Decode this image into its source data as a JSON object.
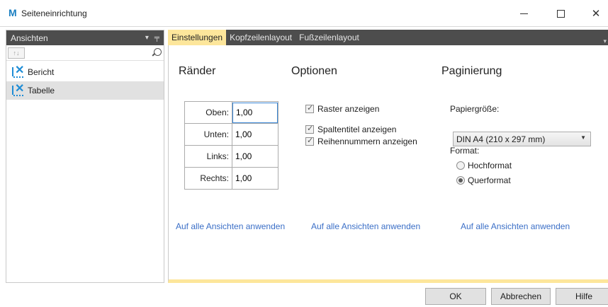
{
  "window": {
    "logo": "M",
    "title": "Seiteneinrichtung"
  },
  "left_panel": {
    "title": "Ansichten",
    "search_placeholder": "",
    "items": [
      {
        "label": "Bericht",
        "selected": false
      },
      {
        "label": "Tabelle",
        "selected": true
      }
    ]
  },
  "tabs": [
    "Einstellungen",
    "Kopfzeilenlayout",
    "Fußzeilenlayout"
  ],
  "active_tab": "Einstellungen",
  "margins": {
    "title": "Ränder",
    "rows": [
      {
        "label": "Oben:",
        "value": "1,00"
      },
      {
        "label": "Unten:",
        "value": "1,00"
      },
      {
        "label": "Links:",
        "value": "1,00"
      },
      {
        "label": "Rechts:",
        "value": "1,00"
      }
    ],
    "apply_link": "Auf alle Ansichten anwenden"
  },
  "options": {
    "title": "Optionen",
    "checkboxes": [
      {
        "label": "Raster anzeigen",
        "checked": true
      },
      {
        "label": "Spaltentitel anzeigen",
        "checked": true
      },
      {
        "label": "Reihennummern anzeigen",
        "checked": true
      }
    ],
    "apply_link": "Auf alle Ansichten anwenden"
  },
  "pagination": {
    "title": "Paginierung",
    "paper_size_label": "Papiergröße:",
    "paper_size_value": "DIN A4 (210 x 297 mm)",
    "format_label": "Format:",
    "formats": [
      {
        "label": "Hochformat",
        "checked": false
      },
      {
        "label": "Querformat",
        "checked": true
      }
    ],
    "apply_link": "Auf alle Ansichten anwenden"
  },
  "buttons": {
    "ok": "OK",
    "cancel": "Abbrechen",
    "help": "Hilfe"
  },
  "colors": {
    "accent_tab": "#fde69b",
    "panel_header": "#4d4d4d",
    "link": "#3b6fc7"
  }
}
